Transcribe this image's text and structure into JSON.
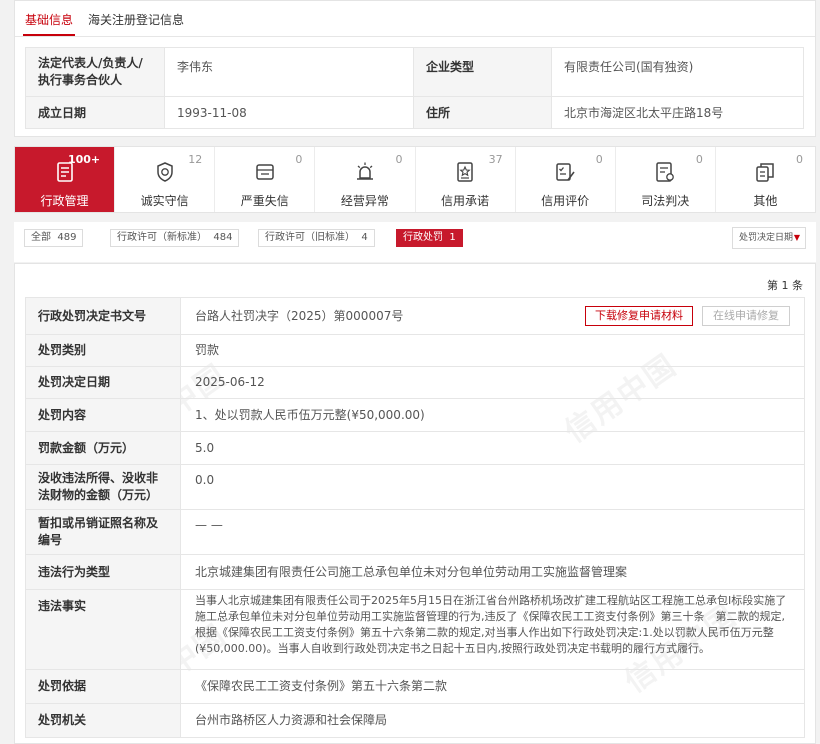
{
  "top_tabs": [
    "基础信息",
    "海关注册登记信息"
  ],
  "basic_info": {
    "legal_rep_label": "法定代表人/负责人/执行事务合伙人",
    "legal_rep_value": "李伟东",
    "company_type_label": "企业类型",
    "company_type_value": "有限责任公司(国有独资)",
    "founded_label": "成立日期",
    "founded_value": "1993-11-08",
    "address_label": "住所",
    "address_value": "北京市海淀区北太平庄路18号"
  },
  "categories": [
    {
      "label": "行政管理",
      "count": "100+",
      "icon": "document-list-icon",
      "active": true
    },
    {
      "label": "诚实守信",
      "count": "12",
      "icon": "shield-badge-icon",
      "active": false
    },
    {
      "label": "严重失信",
      "count": "0",
      "icon": "dishonest-ticket-icon",
      "active": false
    },
    {
      "label": "经营异常",
      "count": "0",
      "icon": "alarm-light-icon",
      "active": false
    },
    {
      "label": "信用承诺",
      "count": "37",
      "icon": "star-pledge-icon",
      "active": false
    },
    {
      "label": "信用评价",
      "count": "0",
      "icon": "checklist-icon",
      "active": false
    },
    {
      "label": "司法判决",
      "count": "0",
      "icon": "judgment-doc-icon",
      "active": false
    },
    {
      "label": "其他",
      "count": "0",
      "icon": "other-files-icon",
      "active": false
    }
  ],
  "filters": [
    {
      "label": "全部",
      "count": "489",
      "active": false
    },
    {
      "label": "行政许可（新标准）",
      "count": "484",
      "active": false
    },
    {
      "label": "行政许可（旧标准）",
      "count": "4",
      "active": false
    },
    {
      "label": "行政处罚",
      "count": "1",
      "active": true
    }
  ],
  "sort_label": "处罚决定日期",
  "count_text": "第 1 条",
  "watermark": "信用中国",
  "buttons": {
    "download": "下载修复申请材料",
    "online_repair": "在线申请修复"
  },
  "penalty": [
    {
      "label": "行政处罚决定书文号",
      "value": "台路人社罚决字（2025）第000007号"
    },
    {
      "label": "处罚类别",
      "value": "罚款"
    },
    {
      "label": "处罚决定日期",
      "value": "2025-06-12"
    },
    {
      "label": "处罚内容",
      "value": "1、处以罚款人民币伍万元整(¥50,000.00)"
    },
    {
      "label": "罚款金额（万元）",
      "value": "5.0"
    },
    {
      "label": "没收违法所得、没收非法财物的金额（万元）",
      "value": "0.0"
    },
    {
      "label": "暂扣或吊销证照名称及编号",
      "value": "— —"
    },
    {
      "label": "违法行为类型",
      "value": "北京城建集团有限责任公司施工总承包单位未对分包单位劳动用工实施监督管理案"
    },
    {
      "label": "违法事实",
      "value": "当事人北京城建集团有限责任公司于2025年5月15日在浙江省台州路桥机场改扩建工程航站区工程施工总承包I标段实施了施工总承包单位未对分包单位劳动用工实施监督管理的行为,违反了《保障农民工工资支付条例》第三十条　第二款的规定,根据《保障农民工工资支付条例》第五十六条第二款的规定,对当事人作出如下行政处罚决定:1.处以罚款人民币伍万元整(¥50,000.00)。当事人自收到行政处罚决定书之日起十五日内,按照行政处罚决定书载明的履行方式履行。"
    },
    {
      "label": "处罚依据",
      "value": "《保障农民工工资支付条例》第五十六条第二款"
    },
    {
      "label": "处罚机关",
      "value": "台州市路桥区人力资源和社会保障局"
    }
  ]
}
